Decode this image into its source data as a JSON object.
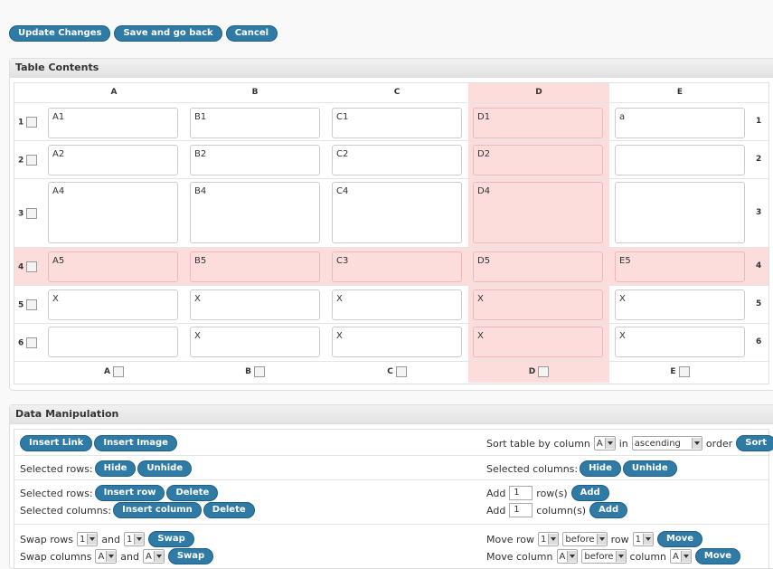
{
  "toolbar": {
    "update_label": "Update Changes",
    "save_back_label": "Save and go back",
    "cancel_label": "Cancel"
  },
  "table_panel": {
    "title": "Table Contents",
    "columns": [
      "A",
      "B",
      "C",
      "D",
      "E"
    ],
    "rows": [
      {
        "num": "1",
        "cells": [
          "A1",
          "B1",
          "C1",
          "D1",
          "a"
        ]
      },
      {
        "num": "2",
        "cells": [
          "A2",
          "B2",
          "C2",
          "D2",
          ""
        ]
      },
      {
        "num": "3",
        "cells": [
          "A4",
          "B4",
          "C4",
          "D4",
          ""
        ]
      },
      {
        "num": "4",
        "cells": [
          "A5",
          "B5",
          "C3",
          "D5",
          "E5"
        ]
      },
      {
        "num": "5",
        "cells": [
          "X",
          "X",
          "X",
          "X",
          "X"
        ]
      },
      {
        "num": "6",
        "cells": [
          "",
          "X",
          "X",
          "X",
          "X"
        ]
      }
    ],
    "highlight_color": "#fddcdc"
  },
  "manip_panel": {
    "title": "Data Manipulation",
    "insert_link": "Insert Link",
    "insert_image": "Insert Image",
    "sort_label": "Sort table by column",
    "sort_col": "A",
    "sort_in": "in",
    "sort_order": "ascending",
    "sort_order_word": "order",
    "sort_button": "Sort",
    "sel_rows_label": "Selected rows:",
    "sel_cols_label": "Selected columns:",
    "hide": "Hide",
    "unhide": "Unhide",
    "insert_row": "Insert row",
    "insert_column": "Insert column",
    "delete": "Delete",
    "add_label": "Add",
    "add_rows_value": "1",
    "add_rows_suffix": "row(s)",
    "add_cols_value": "1",
    "add_cols_suffix": "column(s)",
    "add_button": "Add",
    "swap_rows": "Swap rows",
    "swap_cols": "Swap columns",
    "and": "and",
    "swap_button": "Swap",
    "swap_row_a": "1",
    "swap_row_b": "1",
    "swap_col_a": "A",
    "swap_col_b": "A",
    "move_row": "Move row",
    "move_column": "Move column",
    "move_row_a": "1",
    "move_row_b": "1",
    "move_col_a": "A",
    "move_col_b": "A",
    "before": "before",
    "row_word": "row",
    "column_word": "column",
    "move_button": "Move"
  }
}
